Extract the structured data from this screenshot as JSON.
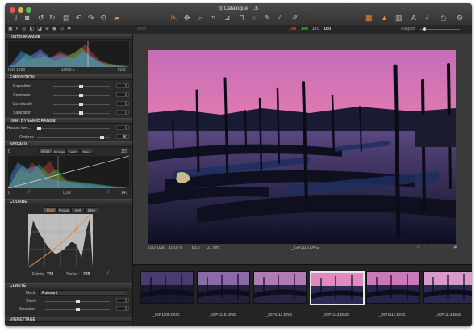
{
  "window": {
    "title": "Catalogue _LK"
  },
  "rgb": {
    "r": "184",
    "g": "146",
    "b": "170",
    "l": "160"
  },
  "adapter": "Adapter",
  "histogram": {
    "header": "HISTOGRAMME",
    "iso": "ISO 1000",
    "shutter": "1/200 s",
    "aperture": "f/3.2"
  },
  "exposure": {
    "header": "EXPOSITION",
    "rows": [
      {
        "label": "Exposition",
        "value": "0"
      },
      {
        "label": "Contraste",
        "value": "0"
      },
      {
        "label": "Luminosité",
        "value": "0"
      },
      {
        "label": "Saturation",
        "value": "0"
      }
    ]
  },
  "hdr": {
    "header": "HIGH DYNAMIC RANGE",
    "rows": [
      {
        "label": "Hautes lum...",
        "value": "0"
      },
      {
        "label": "Ombres",
        "value": "89"
      }
    ]
  },
  "levels": {
    "header": "NIVEAUX",
    "left": "0",
    "right": "255",
    "tabs": [
      "RVB",
      "Rouge",
      "Vert",
      "Bleu"
    ],
    "out_low": "0",
    "mid": "0,02",
    "out_high": "141"
  },
  "curve": {
    "header": "COURBE",
    "tabs": [
      "RVB",
      "Rouge",
      "Vert",
      "Bleu"
    ],
    "input_label": "Entrée",
    "input": "233",
    "output_label": "Sortie :",
    "output": "228"
  },
  "clarity": {
    "header": "CLARTÉ",
    "mode_label": "Mode",
    "mode": "Puissant",
    "rows": [
      {
        "label": "Clarté",
        "value": "0"
      },
      {
        "label": "Structure",
        "value": "0"
      }
    ]
  },
  "vignette": {
    "header": "VIGNETTAGE"
  },
  "viewer": {
    "iso": "ISO 1000",
    "shutter": "1/200 s",
    "aperture": "f/3.2",
    "focal": "21 mm",
    "filename": "_IGP1112.DNG"
  },
  "thumbnails": [
    "_IGP1108.DNG",
    "_IGP1110.DNG",
    "_IGP1111.DNG",
    "_IGP1112.DNG",
    "_IGP1113.DNG",
    "_IGP1114.DNG"
  ],
  "selected_thumbnail": 3,
  "colors": {
    "accent": "#e8883a",
    "r": "#e04040",
    "g": "#40c040",
    "b": "#4aa0ff"
  }
}
